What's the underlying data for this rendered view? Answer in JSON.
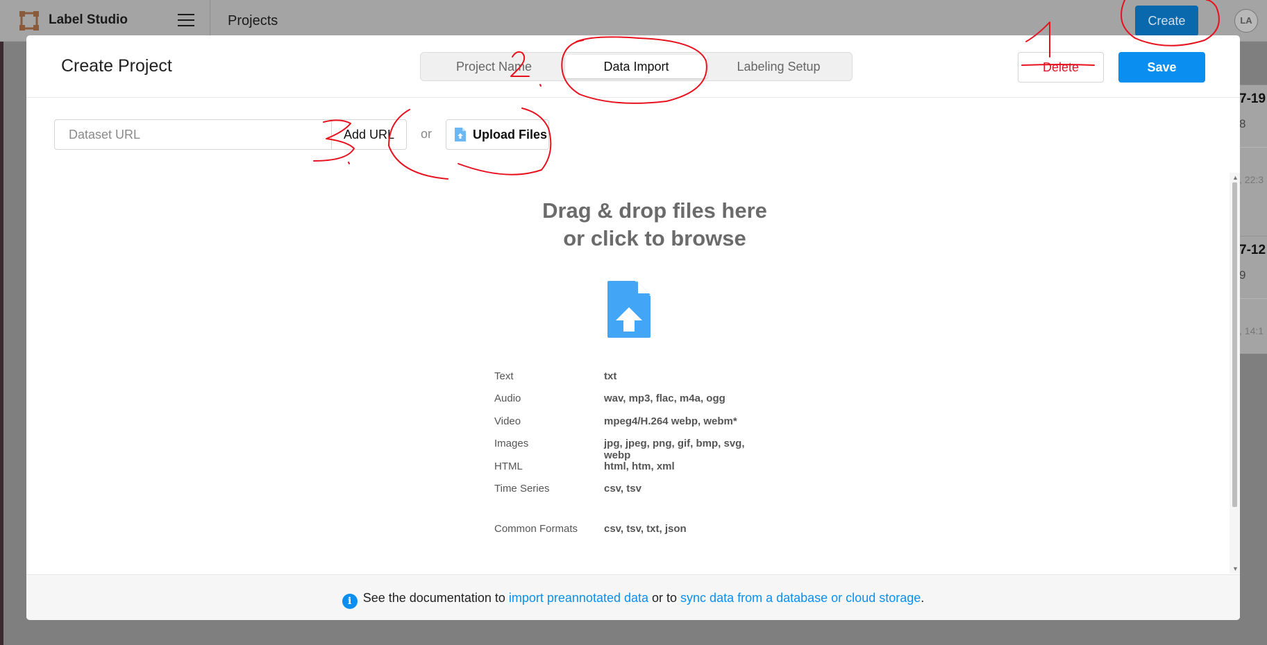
{
  "app": {
    "brand": "Label Studio",
    "page_title": "Projects",
    "create_label": "Create",
    "avatar_initials": "LA"
  },
  "background_cards": [
    {
      "title": "7-19",
      "count": "8",
      "time": ", 22:3"
    },
    {
      "title": "7-12",
      "count": "9",
      "time": ", 14:1"
    }
  ],
  "modal": {
    "title": "Create Project",
    "tabs": [
      {
        "label": "Project Name",
        "active": false
      },
      {
        "label": "Data Import",
        "active": true
      },
      {
        "label": "Labeling Setup",
        "active": false
      }
    ],
    "delete_label": "Delete",
    "save_label": "Save"
  },
  "import": {
    "url_placeholder": "Dataset URL",
    "add_url_label": "Add URL",
    "or_text": "or",
    "upload_label": "Upload Files"
  },
  "dropzone": {
    "line1": "Drag & drop files here",
    "line2": "or click to browse"
  },
  "formats": [
    {
      "label": "Text",
      "value": "txt"
    },
    {
      "label": "Audio",
      "value": "wav, mp3, flac, m4a, ogg"
    },
    {
      "label": "Video",
      "value": "mpeg4/H.264 webp, webm*"
    },
    {
      "label": "Images",
      "value": "jpg, jpeg, png, gif, bmp, svg, webp"
    },
    {
      "label": "HTML",
      "value": "html, htm, xml"
    },
    {
      "label": "Time Series",
      "value": "csv, tsv"
    },
    {
      "label": "Common Formats",
      "value": "csv, tsv, txt, json"
    }
  ],
  "footer": {
    "prefix": "See the documentation to ",
    "link1": "import preannotated data",
    "middle": " or to ",
    "link2": "sync data from a database or cloud storage",
    "suffix": "."
  },
  "annotations": {
    "numbers": [
      "1",
      "2",
      "3"
    ]
  },
  "colors": {
    "accent": "#0a8ff0",
    "delete": "#d8192a",
    "annotation": "#e8111e"
  }
}
